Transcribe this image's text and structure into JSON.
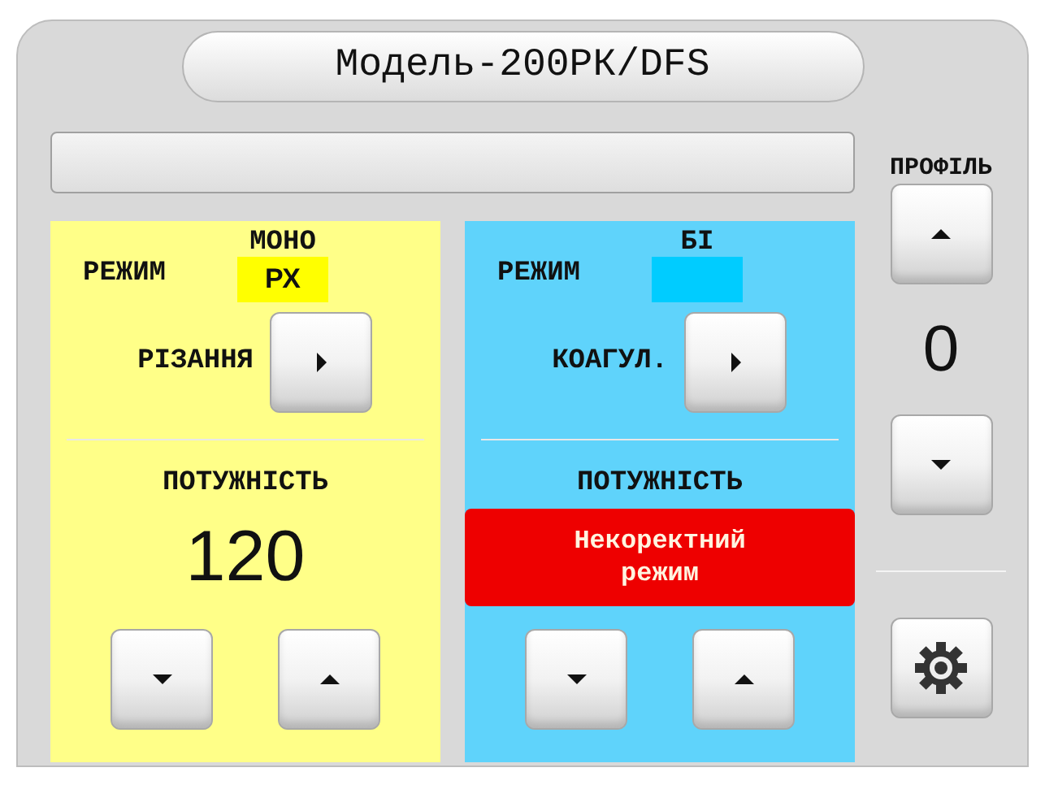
{
  "window": {
    "title": "Модель-200РК/DFS"
  },
  "profile": {
    "label": "ПРОФІЛЬ",
    "value": "0"
  },
  "panels": [
    {
      "color": "#ffff88",
      "mode_label": "РЕЖИМ",
      "mode_type": "МОНО",
      "tag": {
        "text": "РХ",
        "color": "#ffff00"
      },
      "function": "РІЗАННЯ",
      "power_label": "ПОТУЖНІСТЬ",
      "power": {
        "kind": "value",
        "text": "120"
      }
    },
    {
      "color": "#5fd3fb",
      "mode_label": "РЕЖИМ",
      "mode_type": "БІ",
      "tag": {
        "color": "#00ccff"
      },
      "function": "КОАГУЛ.",
      "power_label": "ПОТУЖНІСТЬ",
      "power": {
        "kind": "error",
        "text": "Некоректний режим"
      }
    }
  ]
}
